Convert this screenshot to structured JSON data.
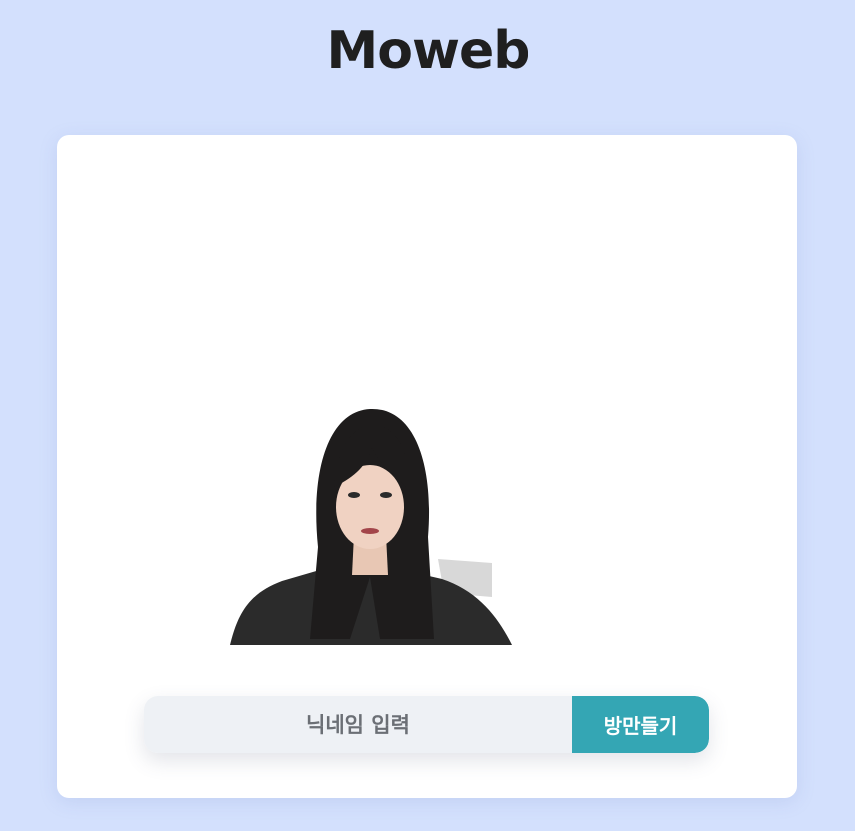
{
  "app": {
    "logo_text": "Moweb"
  },
  "camera": {
    "icon": "user-video-feed"
  },
  "form": {
    "nickname_placeholder": "닉네임 입력",
    "nickname_value": "",
    "create_button_label": "방만들기"
  },
  "colors": {
    "background": "#d3e0fd",
    "card": "#ffffff",
    "button": "#34a6b4",
    "input": "#eef1f5"
  }
}
